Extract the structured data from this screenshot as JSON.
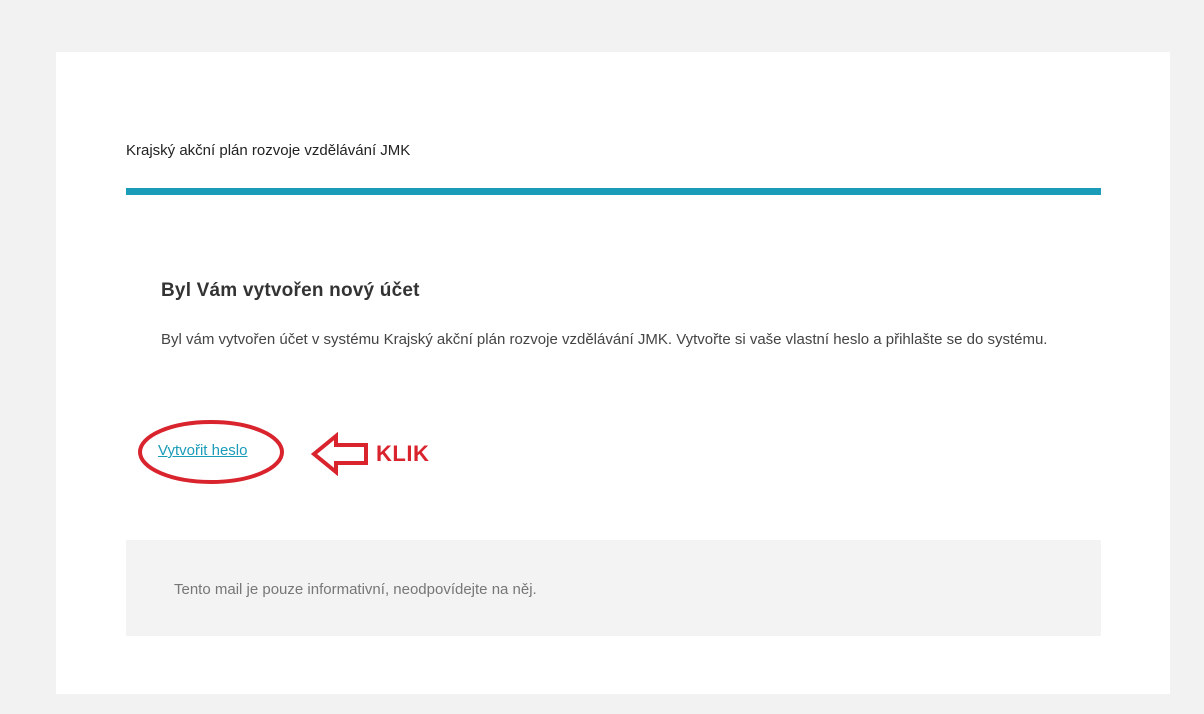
{
  "email": {
    "brand": "Krajský akční plán rozvoje vzdělávání JMK",
    "heading": "Byl Vám vytvořen nový účet",
    "body": "Byl vám vytvořen účet v systému Krajský akční plán rozvoje vzdělávání JMK. Vytvořte si vaše vlastní heslo a přihlašte se do systému.",
    "create_password_link": "Vytvořit heslo",
    "footer_note": "Tento mail je pouze informativní, neodpovídejte na něj."
  },
  "annotation": {
    "label": "KLIK"
  },
  "colors": {
    "accent": "#1a9bb8",
    "link": "#1a9bb8",
    "annotation": "#d9232d"
  }
}
